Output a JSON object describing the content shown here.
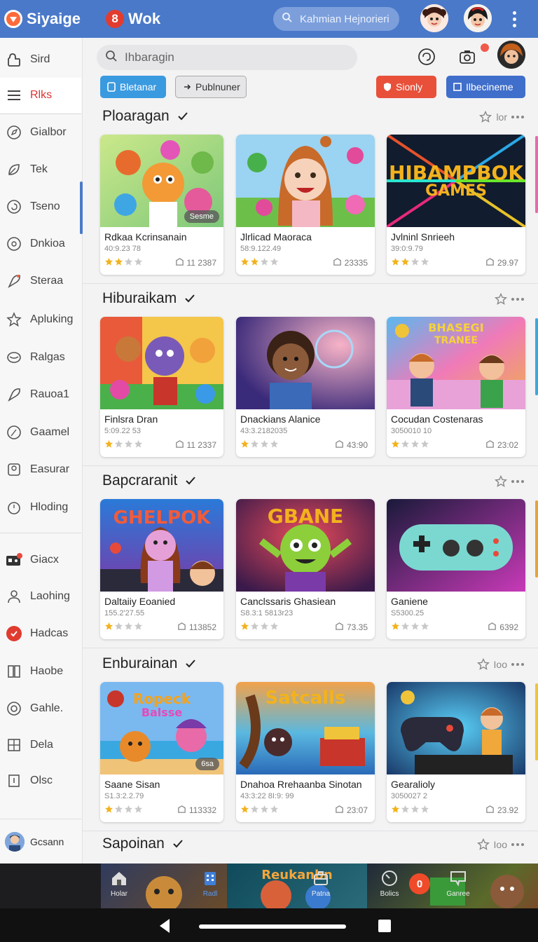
{
  "topbar": {
    "logo_text": "Siyaige",
    "brand2_badge": "8",
    "brand2_text": "Wok",
    "search_text": "Kahmian Hejnorieri",
    "icons": [
      "search-icon",
      "more-vertical-icon"
    ]
  },
  "sidebar": {
    "items": [
      {
        "label": "Sird",
        "icon": "bag-icon"
      },
      {
        "label": "Rlks",
        "icon": "menu-icon",
        "active": true
      },
      {
        "label": "Gialbor",
        "icon": "compass-icon"
      },
      {
        "label": "Tek",
        "icon": "leaf-icon"
      },
      {
        "label": "Tseno",
        "icon": "swirl-icon"
      },
      {
        "label": "Dnkioa",
        "icon": "circle-dot-icon"
      },
      {
        "label": "Steraa",
        "icon": "rocket-icon"
      },
      {
        "label": "Apluking",
        "icon": "star-icon"
      },
      {
        "label": "Ralgas",
        "icon": "dish-icon"
      },
      {
        "label": "Rauoa1",
        "icon": "rocket-icon"
      },
      {
        "label": "Gaamel",
        "icon": "gauge-icon"
      },
      {
        "label": "Easurar",
        "icon": "badge-icon"
      },
      {
        "label": "Hloding",
        "icon": "timer-icon"
      },
      {
        "label": "Giacx",
        "icon": "gamepad-icon"
      },
      {
        "label": "Laohing",
        "icon": "person-icon"
      },
      {
        "label": "Hadcas",
        "icon": "record-icon"
      },
      {
        "label": "Haobe",
        "icon": "book-icon"
      },
      {
        "label": "Gahle.",
        "icon": "target-icon"
      },
      {
        "label": "Dela",
        "icon": "grid-icon"
      },
      {
        "label": "Olsc",
        "icon": "square-icon"
      }
    ],
    "user_label": "Gcsann"
  },
  "main": {
    "search_text": "Ihbaragin",
    "chips": [
      {
        "label": "Bletanar",
        "color": "#3a9ae0"
      },
      {
        "label": "Publnuner",
        "color": "#e6e6e8"
      },
      {
        "label": "Sionly",
        "color": "#e8503a"
      },
      {
        "label": "Ilbecineme",
        "color": "#3f6ecb"
      }
    ],
    "sections": [
      {
        "title": "Ploaragan",
        "more": "lor",
        "cards": [
          {
            "title": "Rdkaa Kcrinsanain",
            "sub": "40:9.23 78",
            "count": "11 2387",
            "badge": "Sesme"
          },
          {
            "title": "Jlrlicad Maoraca",
            "sub": "58:9.122.49",
            "count": "23335"
          },
          {
            "title": "Jvlninl Snrieeh",
            "sub": "39:0:9.79",
            "count": "29.97",
            "thumb_text_1": "HIBAMPBOK",
            "thumb_text_2": "GAMES"
          }
        ]
      },
      {
        "title": "Hiburaikam",
        "more": "",
        "cards": [
          {
            "title": "Finlsra Dran",
            "sub": "5:09.22 53",
            "count": "11 2337"
          },
          {
            "title": "Dnackians Alanice",
            "sub": "43:3.2182035",
            "count": "43:90"
          },
          {
            "title": "Cocudan Costenaras",
            "sub": "3050010 10",
            "count": "23:02",
            "thumb_text_1": "BHASEGI",
            "thumb_text_2": "TRANEE"
          }
        ]
      },
      {
        "title": "Bapcraranit",
        "more": "",
        "cards": [
          {
            "title": "Daltaiiy Eoanied",
            "sub": "155.2'27.55",
            "count": "113852",
            "thumb_text_1": "GHELPOK"
          },
          {
            "title": "Canclssaris Ghasiean",
            "sub": "S8.3:1 5813r23",
            "count": "73.35",
            "thumb_text_1": "GBANE"
          },
          {
            "title": "Ganiene",
            "sub": "S5300.25",
            "count": "6392"
          }
        ]
      },
      {
        "title": "Enburainan",
        "more": "Ioo",
        "cards": [
          {
            "title": "Saane Sisan",
            "sub": "S1.3:2.2.79",
            "count": "113332",
            "badge": "6sa",
            "thumb_text_1": "Ropeck",
            "thumb_text_2": "Balsse"
          },
          {
            "title": "Dnahoa Rrehaanba Sinotan",
            "sub": "43:3:22 8I:9: 99",
            "count": "23:07",
            "thumb_text_1": "Satcalls"
          },
          {
            "title": "Gearalioly",
            "sub": "3050027 2",
            "count": "23.92"
          }
        ]
      },
      {
        "title": "Sapoinan",
        "more": "Ioo",
        "cards": []
      }
    ]
  },
  "bottomnav": {
    "items": [
      {
        "label": "Holar",
        "icon": "home-icon"
      },
      {
        "label": "Radl",
        "icon": "building-icon"
      },
      {
        "label": "Patna",
        "icon": "briefcase-icon"
      },
      {
        "label": "Bolics",
        "icon": "clock-icon"
      },
      {
        "label": "Ganree",
        "icon": "chat-icon"
      }
    ],
    "tile_text": "Reukanbn",
    "badge": "0"
  },
  "colors": {
    "topbar": "#4a79c9",
    "accent_red": "#d33333",
    "star_gold": "#f2b21c"
  }
}
